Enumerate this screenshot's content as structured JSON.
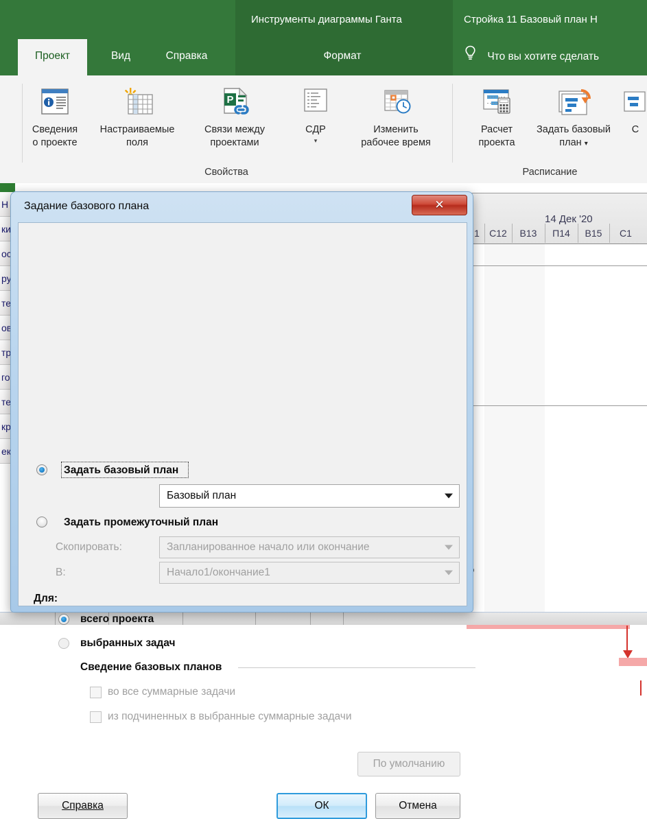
{
  "ribbon": {
    "context_tabs": [
      {
        "name": "gantt_tools",
        "label": "Инструменты диаграммы Ганта"
      },
      {
        "name": "file_title",
        "label": "Стройка 11 Базовый план Н"
      }
    ],
    "tabs": [
      {
        "label": "Проект",
        "active": true
      },
      {
        "label": "Вид",
        "active": false
      },
      {
        "label": "Справка",
        "active": false
      },
      {
        "label": "Формат",
        "active": false
      }
    ],
    "tell_me": "Что вы хотите сделать",
    "groups": [
      {
        "name": "properties",
        "title": "Свойства",
        "buttons": [
          {
            "label_line1": "Сведения",
            "label_line2": "о проекте",
            "icon": "project-information-icon",
            "caret": false
          },
          {
            "label_line1": "Настраиваемые",
            "label_line2": "поля",
            "icon": "custom-fields-icon",
            "caret": false
          },
          {
            "label_line1": "Связи между",
            "label_line2": "проектами",
            "icon": "links-between-projects-icon",
            "caret": false
          },
          {
            "label_line1": "СДР",
            "label_line2": "",
            "icon": "wbs-icon",
            "caret": true
          },
          {
            "label_line1": "Изменить",
            "label_line2": "рабочее время",
            "icon": "change-working-time-icon",
            "caret": false
          }
        ]
      },
      {
        "name": "schedule",
        "title": "Расписание",
        "buttons": [
          {
            "label_line1": "Расчет",
            "label_line2": "проекта",
            "icon": "calculate-project-icon",
            "caret": false
          },
          {
            "label_line1": "Задать базовый",
            "label_line2": "план",
            "icon": "set-baseline-icon",
            "caret": true
          },
          {
            "label_line1": "С",
            "label_line2": "",
            "icon": "move-project-icon",
            "caret": false
          }
        ]
      }
    ]
  },
  "gantt": {
    "timeline_major": "14 Дек '20",
    "timeline_minor": [
      "1",
      "С12",
      "В13",
      "П14",
      "В15",
      "С1"
    ],
    "progress_labels": [
      "%",
      "0%"
    ]
  },
  "task_column_fragments": [
    "Н",
    "ки",
    "ос",
    "ру",
    "те",
    "ов",
    "тр",
    "го",
    "те",
    "кр",
    "ек"
  ],
  "dialog": {
    "title": "Задание базового плана",
    "close_glyph": "✕",
    "baseline_radio": {
      "label": "Задать базовый план",
      "checked": true,
      "focused": true,
      "accesskey_char": "а"
    },
    "baseline_combo": {
      "value": "Базовый план",
      "enabled": true
    },
    "interim_radio": {
      "label": "Задать промежуточный план",
      "checked": false
    },
    "copy_field": {
      "label": "Скопировать:",
      "value": "Запланированное начало или окончание",
      "enabled": false
    },
    "into_field": {
      "label": "В:",
      "value": "Начало1/окончание1",
      "enabled": false
    },
    "for_label": "Для:",
    "scope_options": [
      {
        "label": "всего проекта",
        "checked": true,
        "enabled": true
      },
      {
        "label": "выбранных задач",
        "checked": false,
        "enabled": false
      }
    ],
    "rollup_group_title": "Сведение базовых планов",
    "rollup_checkboxes": [
      {
        "label": "во все суммарные задачи",
        "checked": false,
        "enabled": false
      },
      {
        "label": "из подчиненных в выбранные суммарные задачи",
        "checked": false,
        "enabled": false
      }
    ],
    "buttons": {
      "default_label": "По умолчанию",
      "default_enabled": false,
      "help_label": "Справка",
      "ok_label": "ОК",
      "cancel_label": "Отмена"
    }
  },
  "colors": {
    "ribbon_green": "#34783a",
    "ribbon_green_dark": "#2e6b33",
    "accent_blue": "#2f9bdc",
    "bar_pink": "#f5a8a8",
    "link_red": "#d4322c",
    "close_red": "#cf4a38"
  }
}
